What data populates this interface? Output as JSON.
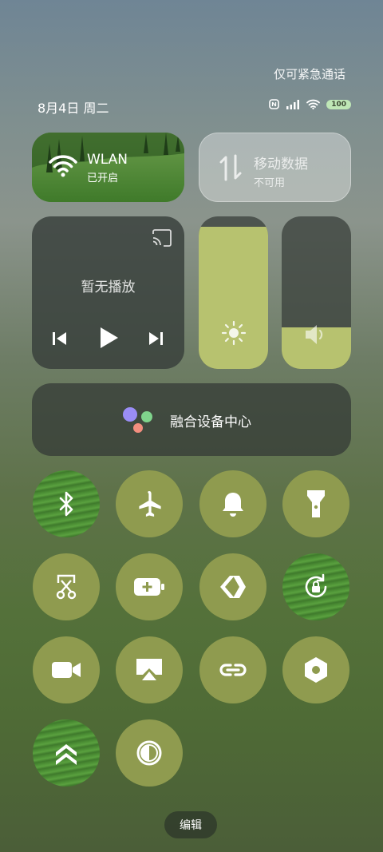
{
  "status": {
    "emergency_text": "仅可紧急通话",
    "date": "8月4日 周二",
    "battery": "100"
  },
  "wlan": {
    "title": "WLAN",
    "subtitle": "已开启"
  },
  "mobile": {
    "title": "移动数据",
    "subtitle": "不可用"
  },
  "media": {
    "status": "暂无播放"
  },
  "brightness": {
    "level_percent": 93
  },
  "volume": {
    "level_percent": 27
  },
  "device_center": {
    "label": "融合设备中心"
  },
  "toggles": [
    {
      "name": "bluetooth",
      "icon": "bluetooth-icon",
      "active": true
    },
    {
      "name": "airplane",
      "icon": "airplane-icon",
      "active": false
    },
    {
      "name": "ringer",
      "icon": "bell-icon",
      "active": false
    },
    {
      "name": "flashlight",
      "icon": "flashlight-icon",
      "active": false
    },
    {
      "name": "screenshot",
      "icon": "scissors-icon",
      "active": false
    },
    {
      "name": "battery-saver",
      "icon": "battery-plus-icon",
      "active": false
    },
    {
      "name": "nearby-share",
      "icon": "share-arrows-icon",
      "active": false
    },
    {
      "name": "rotation-lock",
      "icon": "rotation-lock-icon",
      "active": true
    },
    {
      "name": "screen-record",
      "icon": "video-camera-icon",
      "active": false
    },
    {
      "name": "cast",
      "icon": "airplay-icon",
      "active": false
    },
    {
      "name": "link",
      "icon": "link-icon",
      "active": false
    },
    {
      "name": "settings",
      "icon": "hexagon-icon",
      "active": false
    },
    {
      "name": "performance",
      "icon": "chevrons-up-icon",
      "active": true
    },
    {
      "name": "invert",
      "icon": "contrast-icon",
      "active": false
    }
  ],
  "edit_label": "编辑"
}
